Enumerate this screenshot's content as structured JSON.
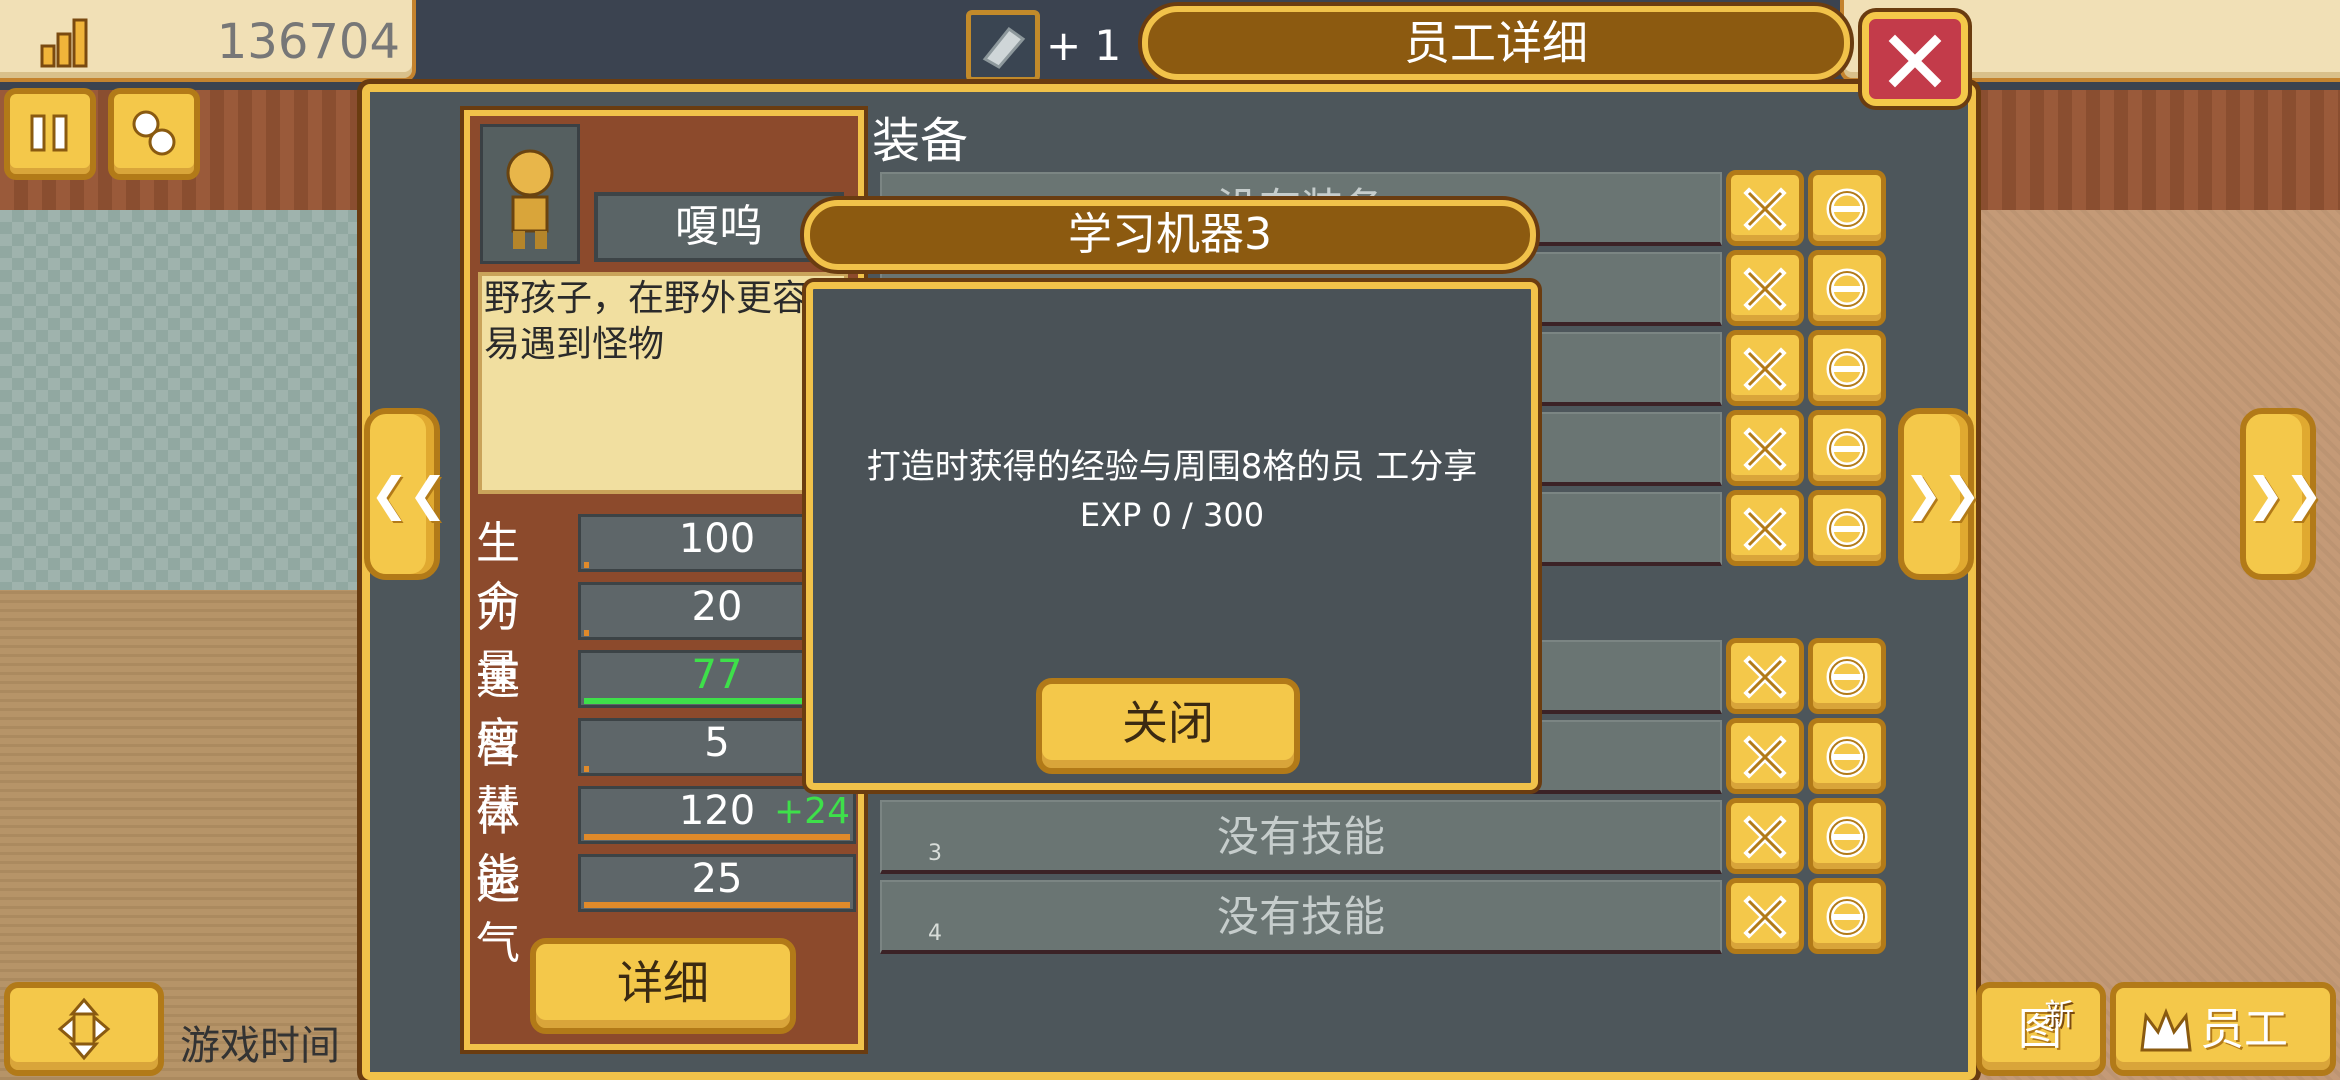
{
  "hud": {
    "money": "136704",
    "item_bonus": "+ 1",
    "game_time_label": "游戏时间",
    "bottom_partial_label": "图鉴",
    "bottom_new_badge": "新",
    "staff_label": "员工"
  },
  "staff_panel": {
    "title": "员工详细",
    "character": {
      "name": "嗄呜",
      "description": "野孩子，在野外更容易遇到怪物"
    },
    "stats": [
      {
        "label": "生命",
        "value": "100",
        "bonus": "",
        "fill": 0.0,
        "highlight": false
      },
      {
        "label": "力量",
        "value": "20",
        "bonus": "",
        "fill": 0.0,
        "highlight": false
      },
      {
        "label": "速度",
        "value": "77",
        "bonus": "",
        "fill": 1.0,
        "highlight": true
      },
      {
        "label": "智慧",
        "value": "5",
        "bonus": "",
        "fill": 0.0,
        "highlight": false
      },
      {
        "label": "体能",
        "value": "120",
        "bonus": "+24",
        "fill": 1.0,
        "highlight": false
      },
      {
        "label": "运气",
        "value": "25",
        "bonus": "",
        "fill": 1.0,
        "highlight": false
      }
    ],
    "detail_button": "详细",
    "equip_title": "装备",
    "equipment_partial": "没有装备",
    "skills": [
      {
        "digit": "3",
        "label": "没有技能"
      },
      {
        "digit": "4",
        "label": "没有技能"
      }
    ]
  },
  "popup": {
    "title": "学习机器3",
    "description": "打造时获得的经验与周围8格的员 工分享",
    "exp_line": "EXP 0 / 300",
    "close_button": "关闭"
  },
  "colors": {
    "gold": "#f4c84a",
    "gold_border": "#b27a18",
    "ribbon": "#8c5a10",
    "panel": "#4d565b",
    "close_red": "#c33b4a",
    "speed_green": "#3ee04a",
    "stat_fill": "#e08a2a"
  },
  "icons": [
    "money-icon",
    "pause-icon",
    "speed-icon",
    "item-icon",
    "close-icon",
    "left-arrow-icon",
    "right-arrow-icon",
    "x-icon",
    "swap-icon",
    "move-icon",
    "crown-icon"
  ]
}
